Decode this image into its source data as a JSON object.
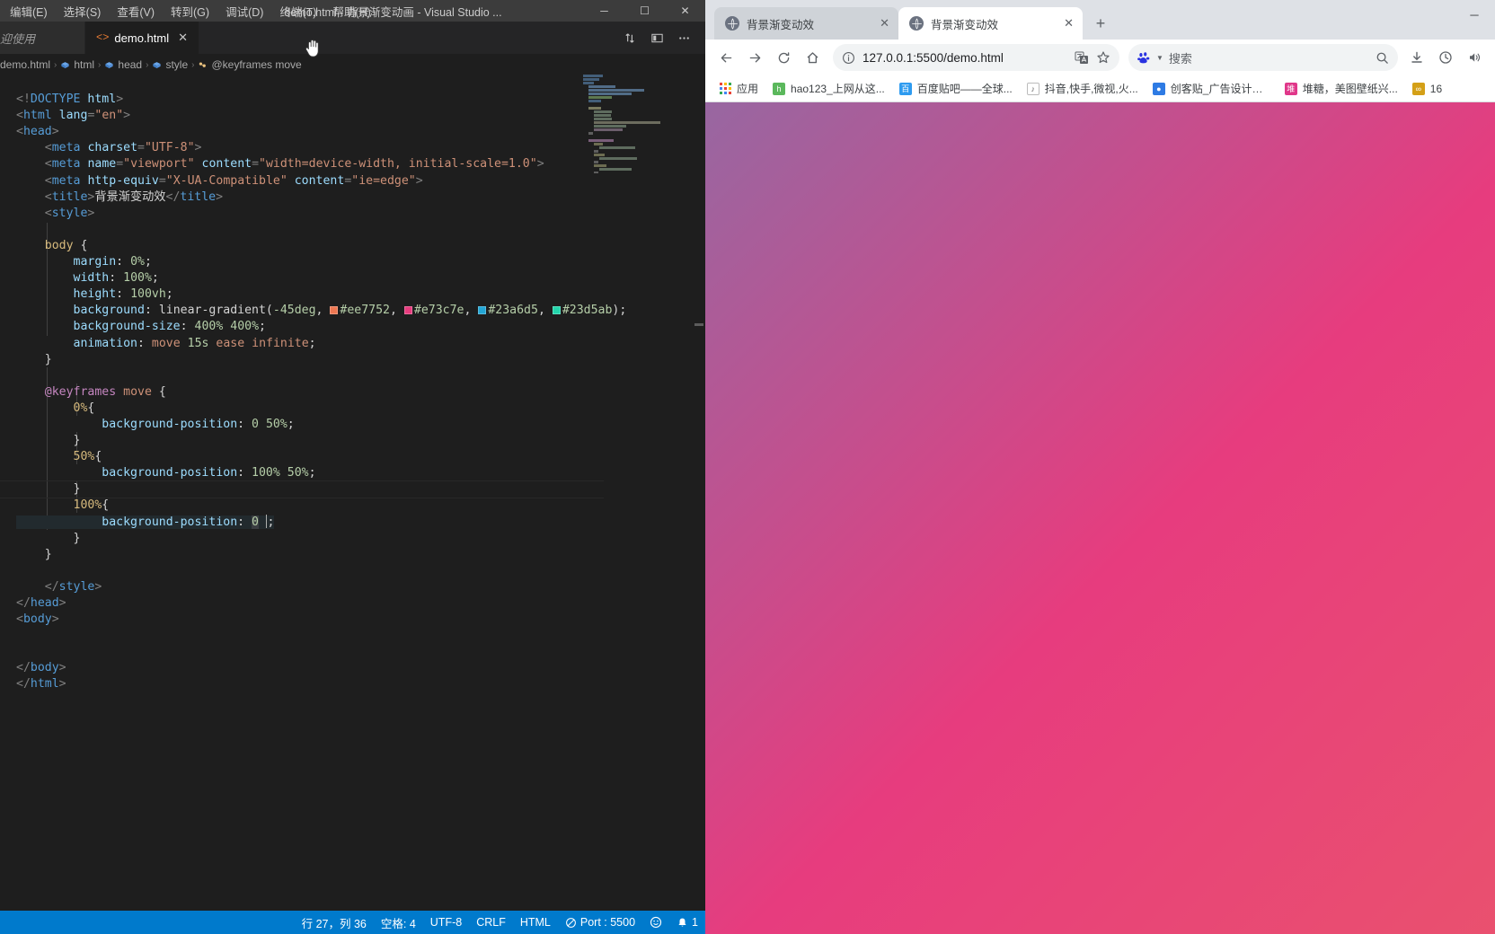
{
  "vscode": {
    "window_title": "demo.html - 背景渐变动画 - Visual Studio ...",
    "menu": [
      {
        "label": "编辑(E)"
      },
      {
        "label": "选择(S)"
      },
      {
        "label": "查看(V)"
      },
      {
        "label": "转到(G)"
      },
      {
        "label": "调试(D)"
      },
      {
        "label": "终端(T)"
      },
      {
        "label": "帮助(H)"
      }
    ],
    "window_controls": {
      "minimize": "─",
      "maximize": "☐",
      "close": "✕"
    },
    "tabs": [
      {
        "label": "迎使用",
        "icon": "",
        "active": false,
        "close": ""
      },
      {
        "label": "demo.html",
        "icon": "<>",
        "active": true,
        "close": "✕"
      }
    ],
    "tab_actions": [
      {
        "name": "split-editor-icon",
        "glyph": "⇅"
      },
      {
        "name": "editor-layout-icon",
        "glyph": "▥"
      },
      {
        "name": "more-actions-icon",
        "glyph": "⋯"
      }
    ],
    "breadcrumb": [
      {
        "label": "demo.html",
        "icon": "file"
      },
      {
        "label": "html",
        "icon": "tag"
      },
      {
        "label": "head",
        "icon": "tag"
      },
      {
        "label": "style",
        "icon": "tag"
      },
      {
        "label": "@keyframes move",
        "icon": "rule"
      }
    ],
    "statusbar": {
      "cursor_position": "行 27，列 36",
      "indentation": "空格: 4",
      "encoding": "UTF-8",
      "eol": "CRLF",
      "language": "HTML",
      "liveserver": "Port : 5500",
      "feedback_icon": "☺",
      "bell_icon": "ὑ4",
      "notification_count": "1"
    },
    "code": {
      "colors": {
        "c1": "#ee7752",
        "c2": "#e73c7e",
        "c3": "#23a6d5",
        "c4": "#23d5ab"
      },
      "lines": [
        "<!DOCTYPE html>",
        "<html lang=\"en\">",
        "<head>",
        "    <meta charset=\"UTF-8\">",
        "    <meta name=\"viewport\" content=\"width=device-width, initial-scale=1.0\">",
        "    <meta http-equiv=\"X-UA-Compatible\" content=\"ie=edge\">",
        "    <title>背景渐变动效</title>",
        "    <style>",
        "",
        "    body {",
        "        margin: 0%;",
        "        width: 100%;",
        "        height: 100vh;",
        "        background: linear-gradient(-45deg, #ee7752, #e73c7e, #23a6d5, #23d5ab);",
        "        background-size: 400% 400%;",
        "        animation: move 15s ease infinite;",
        "    }",
        "",
        "    @keyframes move {",
        "        0%{",
        "            background-position: 0 50%;",
        "        }",
        "        50%{",
        "            background-position: 100% 50%;",
        "        }",
        "        100%{",
        "            background-position: 0 ;",
        "        }",
        "    }",
        "",
        "    </style>",
        "</head>",
        "<body>",
        "",
        "</body>",
        "</html>"
      ]
    }
  },
  "browser": {
    "tabs": [
      {
        "title": "背景渐变动效",
        "active": false,
        "close_label": "✕"
      },
      {
        "title": "背景渐变动效",
        "active": true,
        "close_label": "✕"
      }
    ],
    "new_tab_label": "+",
    "window_controls": {
      "minimize": "─"
    },
    "toolbar": {
      "back_label": "←",
      "forward_label": "→",
      "reload_label": "⟳",
      "home_label": "⌂",
      "site_info_label": "ⓘ",
      "url": "127.0.0.1:5500/demo.html",
      "translate_label": "译",
      "bookmark_star_label": "☆",
      "search_placeholder": "搜索",
      "search_icon_label": "⌕",
      "download_label": "⬇",
      "history_label": "◴",
      "volume_label": "ὐA"
    },
    "bookmarks": [
      {
        "label": "应用",
        "icon_type": "apps",
        "color": "#4285f4"
      },
      {
        "label": "hao123_上网从这...",
        "icon_type": "letter",
        "glyph": "h",
        "color": "#5bb85c"
      },
      {
        "label": "百度贴吧——全球...",
        "icon_type": "letter",
        "glyph": "百",
        "color": "#2e9bf0"
      },
      {
        "label": "抖音,快手,微视,火...",
        "icon_type": "letter",
        "glyph": "♪",
        "color": "#888888"
      },
      {
        "label": "创客贴_广告设计印...",
        "icon_type": "letter",
        "glyph": "●",
        "color": "#2e7be4"
      },
      {
        "label": "堆糖，美图壁纸兴...",
        "icon_type": "letter",
        "glyph": "堆",
        "color": "#e0378a"
      },
      {
        "label": "16",
        "icon_type": "letter",
        "glyph": "∞",
        "color": "#d4a017"
      }
    ],
    "page": {
      "gradient_colors": [
        "#ee7752",
        "#e73c7e",
        "#23a6d5",
        "#23d5ab"
      ],
      "gradient_angle": "-45deg",
      "background_size": "400% 400%"
    }
  }
}
